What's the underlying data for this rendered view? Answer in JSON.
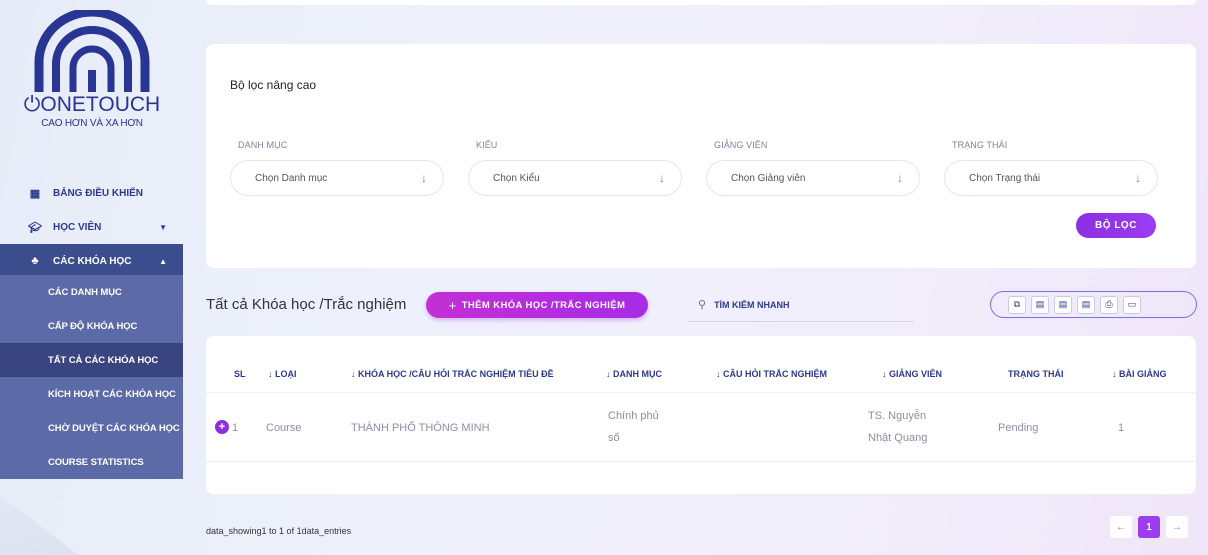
{
  "brand": {
    "name": "ONETOUCH",
    "tagline": "CAO HƠN VÀ XA HƠN"
  },
  "sidebar": {
    "items": [
      {
        "label": "BẢNG ĐIỀU KHIỂN",
        "icon": "grid-icon"
      },
      {
        "label": "HỌC VIÊN",
        "icon": "graduation-cap-icon"
      },
      {
        "label": "CÁC KHÓA HỌC",
        "icon": "layers-icon"
      }
    ],
    "sub_items": [
      "CÁC DANH MỤC",
      "CẤP ĐỘ KHÓA HỌC",
      "TẤT CẢ CÁC KHÓA HỌC",
      "KÍCH HOẠT CÁC KHÓA HỌC",
      "CHỜ DUYỆT CÁC KHÓA HỌC",
      "COURSE STATISTICS"
    ]
  },
  "filter": {
    "title": "Bộ lọc nâng cao",
    "fields": [
      {
        "label": "DANH MỤC",
        "placeholder": "Chọn Danh mục"
      },
      {
        "label": "KIỂU",
        "placeholder": "Chọn Kiểu"
      },
      {
        "label": "GIẢNG VIÊN",
        "placeholder": "Chọn Giảng viên"
      },
      {
        "label": "TRẠNG THÁI",
        "placeholder": "Chọn Trạng thái"
      }
    ],
    "button": "BỘ LỌC"
  },
  "list": {
    "title": "Tất cả Khóa học /Trắc nghiệm",
    "add_button": "THÊM KHÓA HỌC /TRẮC NGHIỆM",
    "search_placeholder": "TÌM KIẾM NHANH"
  },
  "table": {
    "headers": {
      "sl": "SL",
      "loai": "LOẠI",
      "title": "KHÓA HỌC /CÂU HỎI TRẮC NGHIỆM TIÊU ĐỀ",
      "danh_muc": "DANH MỤC",
      "cau_hoi": "CÂU HỎI TRẮC NGHIỆM",
      "giang_vien": "GIẢNG VIÊN",
      "trang_thai": "TRẠNG THÁI",
      "bai_giang": "BÀI GIẢNG"
    },
    "rows": [
      {
        "sl": "1",
        "loai": "Course",
        "title": "THÀNH PHỐ THÔNG MINH",
        "danh_muc_1": "Chính phủ",
        "danh_muc_2": "số",
        "cau_hoi": "",
        "giang_vien_1": "TS. Nguyễn",
        "giang_vien_2": "Nhật Quang",
        "trang_thai": "Pending",
        "bai_giang": "1"
      }
    ]
  },
  "footer": {
    "entries_text": "data_showing1 to 1 of 1data_entries",
    "current_page": "1",
    "prev": "←",
    "next": "→"
  },
  "colors": {
    "primary": "#2d3a8c",
    "accent": "#9b3df0",
    "sidebar_active": "#3c4d8e",
    "sidebar_sub": "#5c6aa7"
  }
}
